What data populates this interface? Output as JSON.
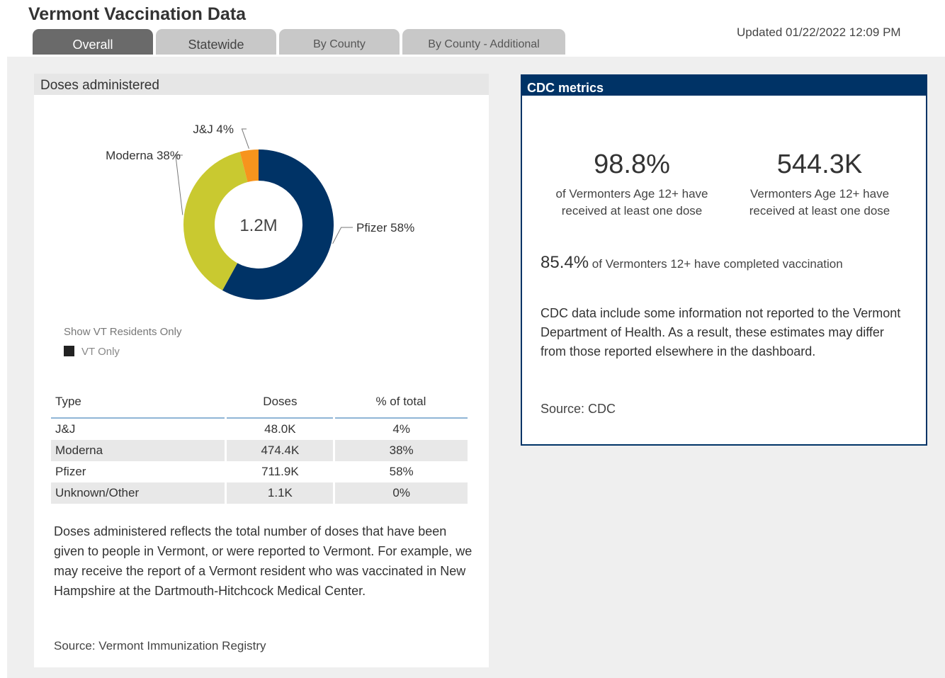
{
  "app_title": "Vermont Vaccination Data",
  "updated": "Updated 01/22/2022 12:09 PM",
  "tabs": [
    {
      "label": "Overall"
    },
    {
      "label": "Statewide"
    },
    {
      "label": "By County"
    },
    {
      "label": "By County - Additional"
    }
  ],
  "doses_panel": {
    "title": "Doses administered",
    "slicer_title": "Show VT Residents Only",
    "slicer_option": "VT Only",
    "table": {
      "headers": [
        "Type",
        "Doses",
        "% of total"
      ],
      "rows": [
        [
          "J&J",
          "48.0K",
          "4%"
        ],
        [
          "Moderna",
          "474.4K",
          "38%"
        ],
        [
          "Pfizer",
          "711.9K",
          "58%"
        ],
        [
          "Unknown/Other",
          "1.1K",
          "0%"
        ]
      ]
    },
    "description": "Doses administered reflects the total number of doses that have been given to people in Vermont, or were reported to Vermont. For example, we may receive the report of a Vermont resident who was vaccinated in New Hampshire at the Dartmouth-Hitchcock Medical Center.",
    "source": "Source: Vermont Immunization Registry"
  },
  "chart_data": {
    "type": "pie",
    "center_label": "1.2M",
    "categories": [
      "J&J",
      "Moderna",
      "Pfizer"
    ],
    "values": [
      4,
      38,
      58
    ],
    "data_labels": [
      "J&J 4%",
      "Moderna 38%",
      "Pfizer 58%"
    ],
    "colors": [
      "#f7941d",
      "#c9c930",
      "#003366"
    ]
  },
  "cdc_panel": {
    "title": "CDC metrics",
    "kpi1_value": "98.8%",
    "kpi1_label_line1": "of Vermonters Age 12+ have",
    "kpi1_label_line2": "received at least one dose",
    "kpi2_value": "544.3K",
    "kpi2_label_line1": "Vermonters Age 12+ have",
    "kpi2_label_line2": "received at least one dose",
    "completed_value": "85.4%",
    "completed_text": "of Vermonters 12+ have completed vaccination",
    "description": "CDC data include some information not reported to the Vermont Department of Health. As a result, these estimates may differ from those reported elsewhere in the dashboard.",
    "source": "Source: CDC"
  }
}
